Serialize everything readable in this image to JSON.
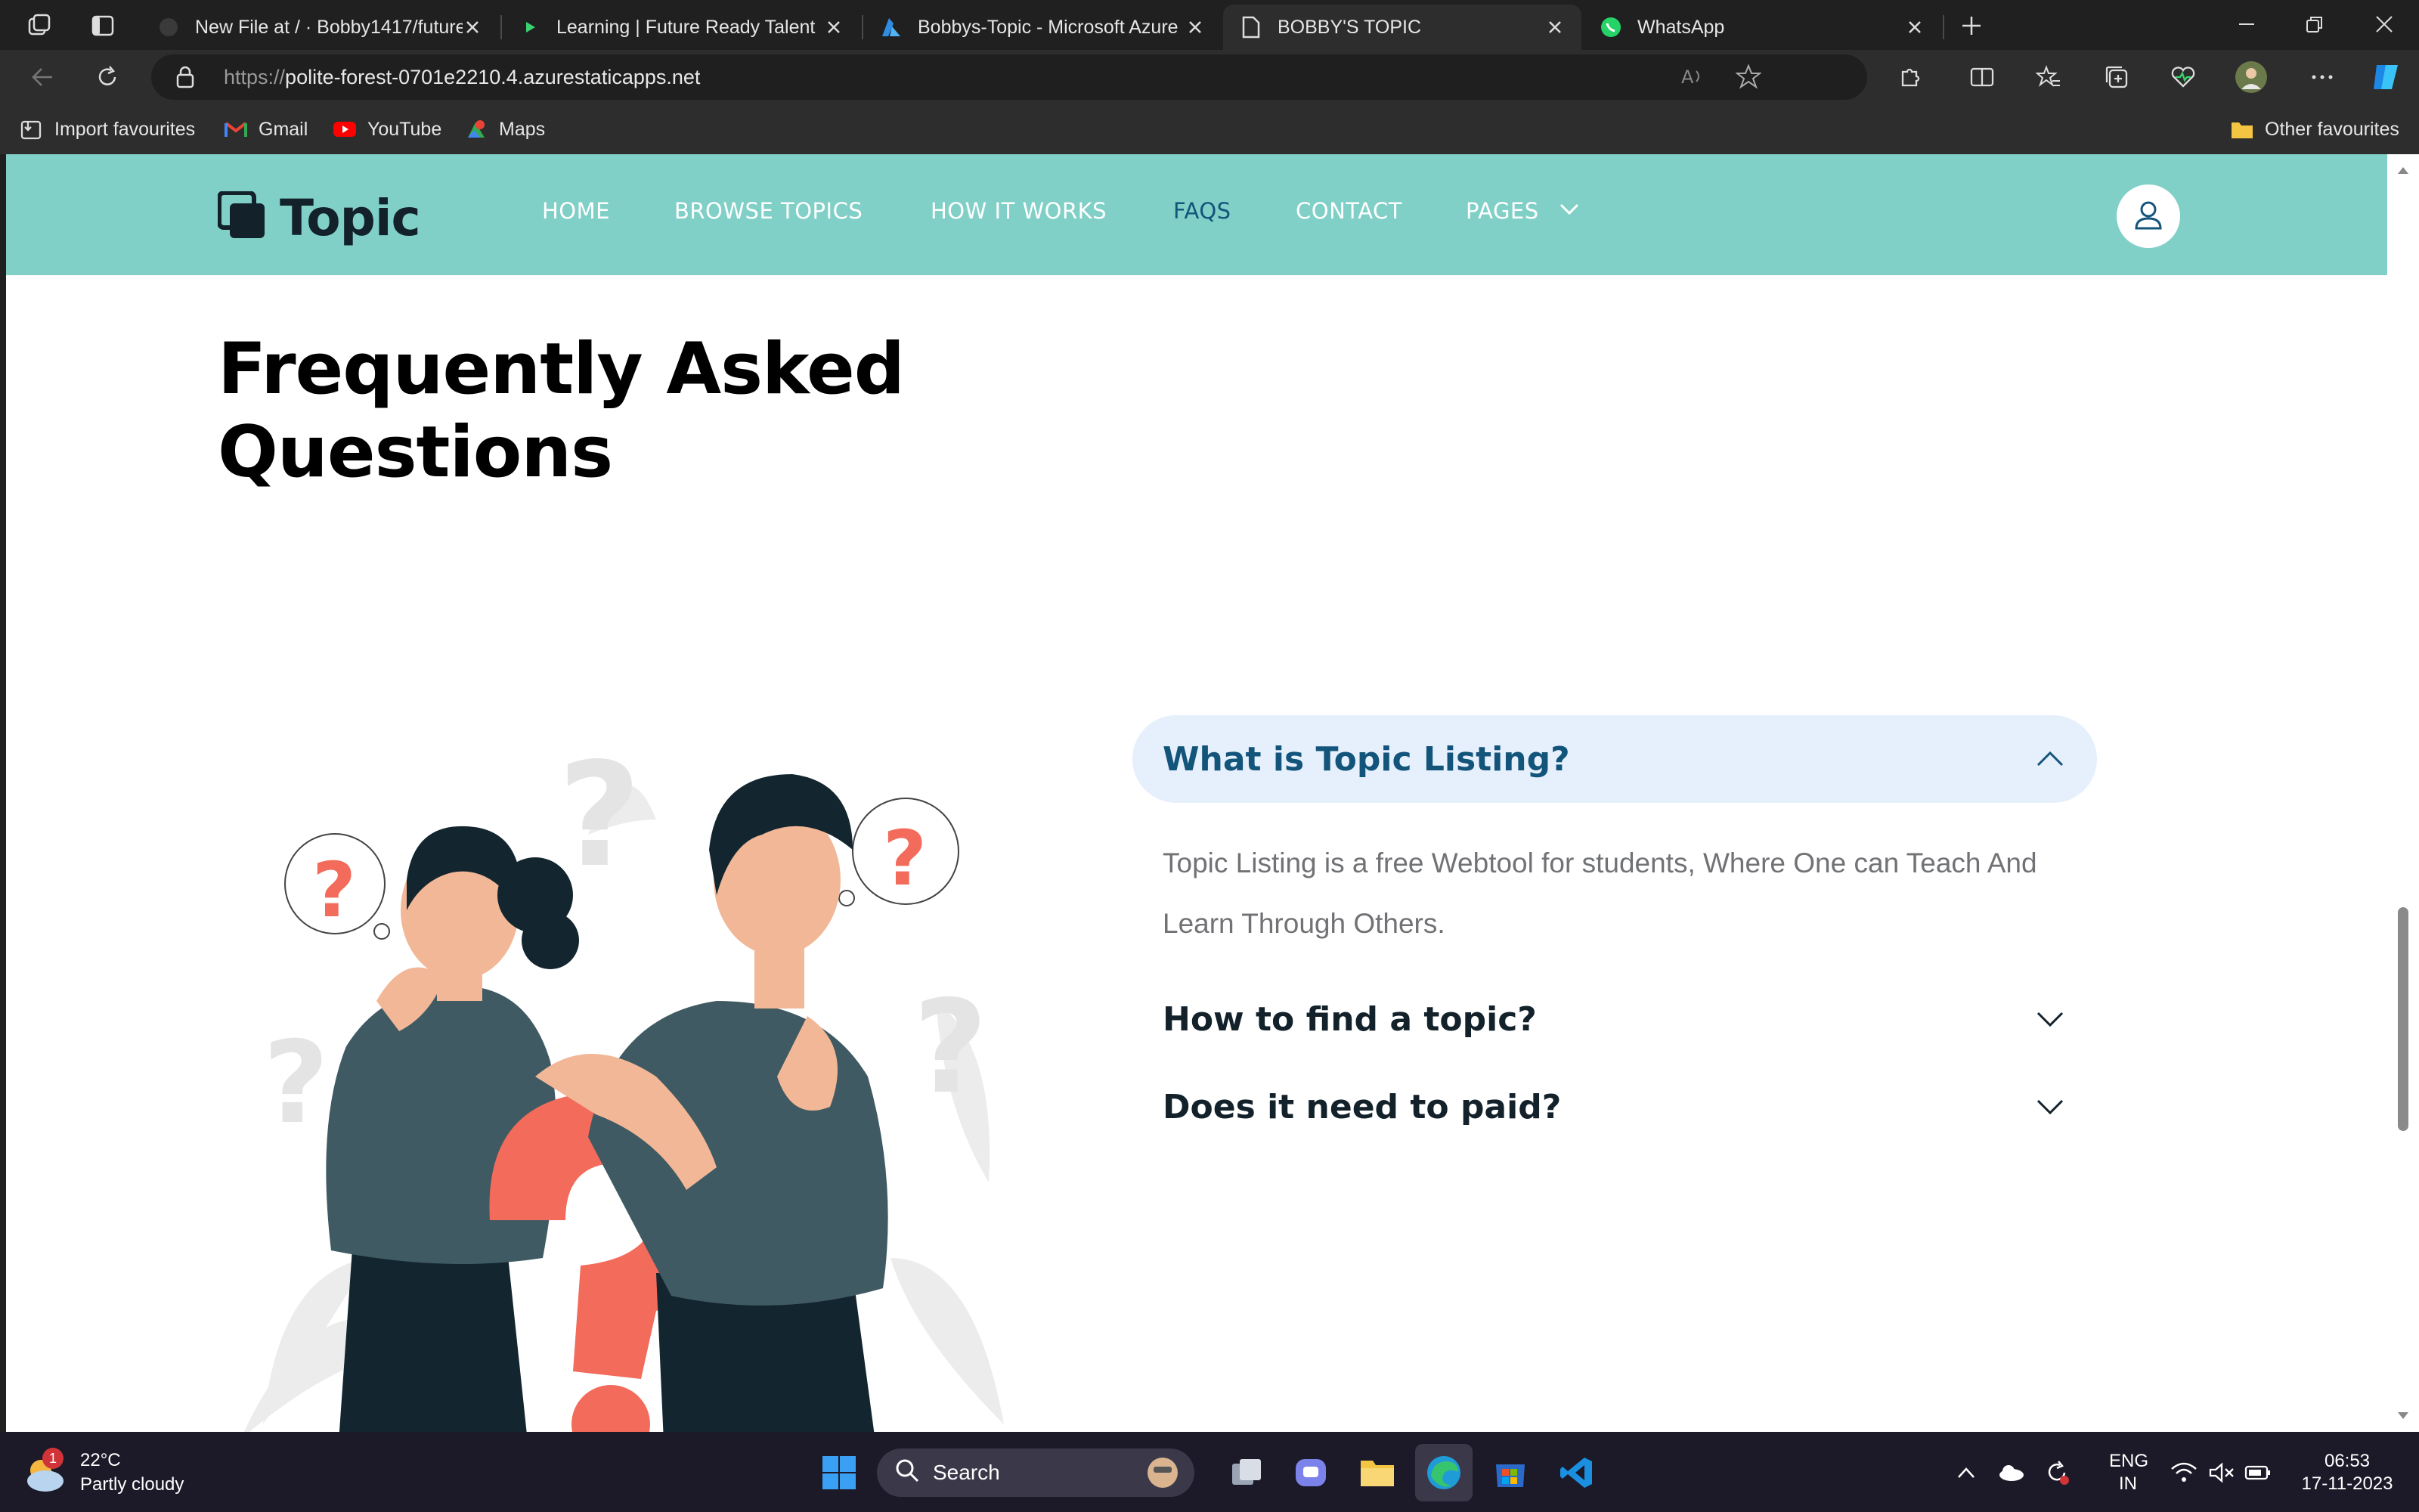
{
  "browser": {
    "tabs": [
      {
        "title": "New File at / · Bobby1417/future",
        "active": false
      },
      {
        "title": "Learning | Future Ready Talent",
        "active": false
      },
      {
        "title": "Bobbys-Topic - Microsoft Azure",
        "active": false
      },
      {
        "title": "BOBBY'S TOPIC",
        "active": true
      },
      {
        "title": "WhatsApp",
        "active": false
      }
    ],
    "url_protocol": "https://",
    "url_host": "polite-forest-0701e2210.4.azurestaticapps.net",
    "favourites": [
      "Import favourites",
      "Gmail",
      "YouTube",
      "Maps"
    ],
    "other_favourites": "Other favourites"
  },
  "site": {
    "logo": "Topic",
    "nav": [
      {
        "label": "HOME",
        "active": false
      },
      {
        "label": "BROWSE TOPICS",
        "active": false
      },
      {
        "label": "HOW IT WORKS",
        "active": false
      },
      {
        "label": "FAQS",
        "active": true
      },
      {
        "label": "CONTACT",
        "active": false
      },
      {
        "label": "PAGES",
        "active": false
      }
    ],
    "faq_title_line1": "Frequently Asked",
    "faq_title_line2": "Questions",
    "faqs": [
      {
        "question": "What is Topic Listing?",
        "answer": "Topic Listing is a free Webtool for students, Where One can Teach And Learn Through Others.",
        "open": true
      },
      {
        "question": "How to find a topic?",
        "answer": "",
        "open": false
      },
      {
        "question": "Does it need to paid?",
        "answer": "",
        "open": false
      }
    ]
  },
  "taskbar": {
    "weather_temp": "22°C",
    "weather_desc": "Partly cloudy",
    "weather_badge": "1",
    "search_label": "Search",
    "lang_line1": "ENG",
    "lang_line2": "IN",
    "time": "06:53",
    "date": "17-11-2023"
  },
  "colors": {
    "nav_bg": "#80d0c7",
    "accent": "#13547a",
    "open_faq_bg": "#e6f0fd",
    "illustration_red": "#f26b5b",
    "illustration_dark": "#3f5a63"
  }
}
